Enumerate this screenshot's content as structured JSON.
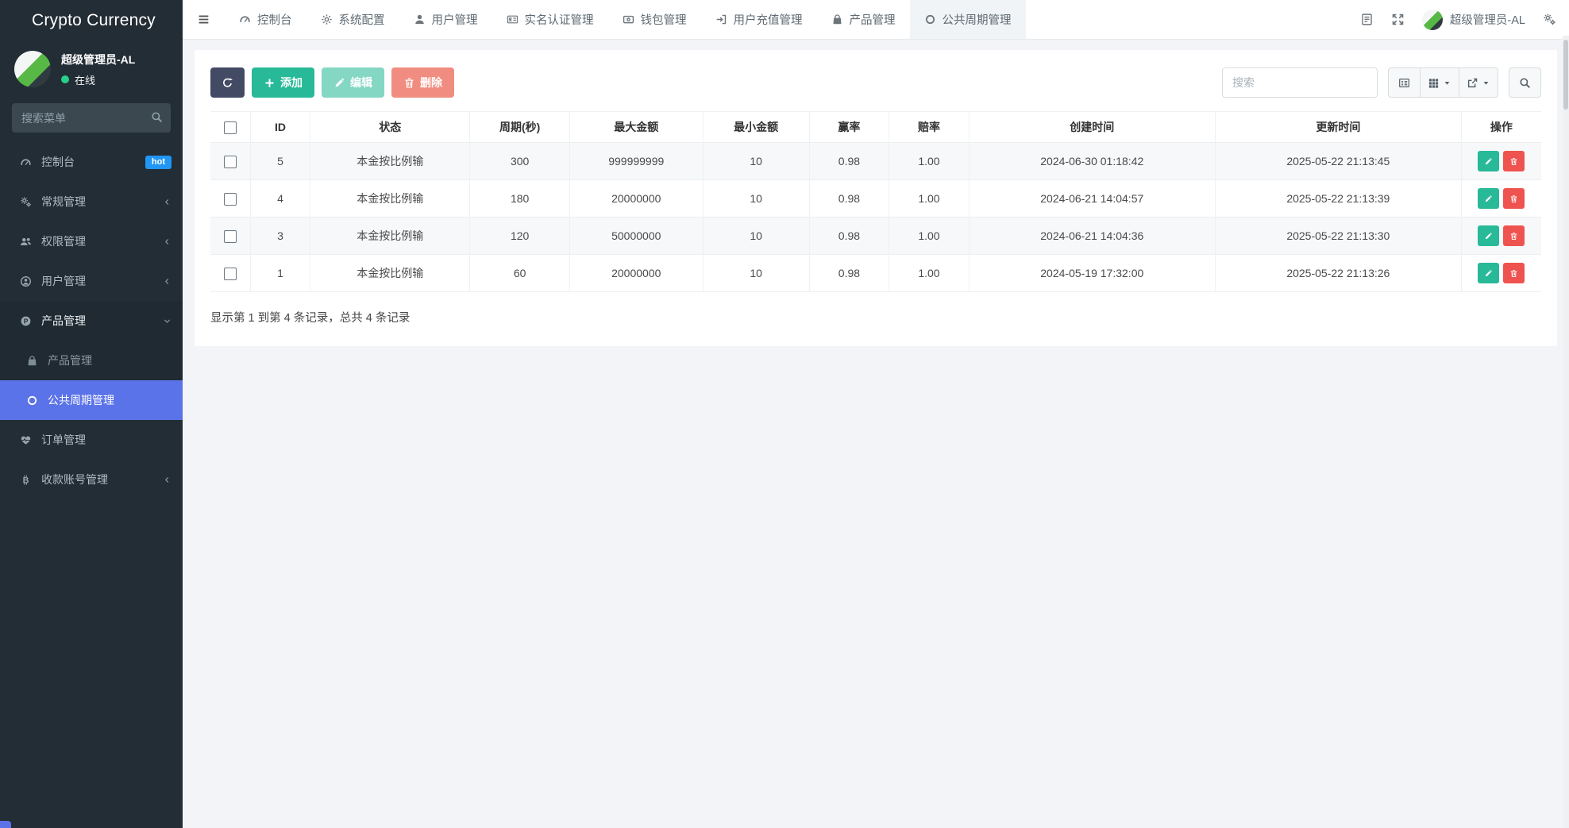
{
  "brand": {
    "title": "Crypto Currency"
  },
  "sidebar": {
    "user": {
      "name": "超级管理员-AL",
      "status_label": "在线"
    },
    "search_placeholder": "搜索菜单",
    "items": [
      {
        "label": "控制台",
        "icon": "dashboard-icon",
        "badge": "hot"
      },
      {
        "label": "常规管理",
        "icon": "cogs-icon",
        "chevron": "left"
      },
      {
        "label": "权限管理",
        "icon": "users-icon",
        "chevron": "left"
      },
      {
        "label": "用户管理",
        "icon": "user-circle-icon",
        "chevron": "left"
      },
      {
        "label": "产品管理",
        "icon": "product-icon",
        "chevron": "down",
        "expanded": true,
        "children": [
          {
            "label": "产品管理",
            "icon": "shopping-bag-icon"
          },
          {
            "label": "公共周期管理",
            "icon": "circle-icon",
            "active": true
          }
        ]
      },
      {
        "label": "订单管理",
        "icon": "heartbeat-icon"
      },
      {
        "label": "收款账号管理",
        "icon": "bitcoin-icon",
        "chevron": "left"
      }
    ]
  },
  "topnav": {
    "tabs": [
      {
        "label": "控制台",
        "icon": "dashboard-icon"
      },
      {
        "label": "系统配置",
        "icon": "gear-icon"
      },
      {
        "label": "用户管理",
        "icon": "user-icon"
      },
      {
        "label": "实名认证管理",
        "icon": "id-card-icon"
      },
      {
        "label": "钱包管理",
        "icon": "wallet-icon"
      },
      {
        "label": "用户充值管理",
        "icon": "sign-in-icon"
      },
      {
        "label": "产品管理",
        "icon": "shopping-bag-icon"
      },
      {
        "label": "公共周期管理",
        "icon": "circle-icon",
        "active": true
      }
    ],
    "right": {
      "username": "超级管理员-AL",
      "icons": [
        "document-icon",
        "fullscreen-icon",
        "avatar",
        "gears-icon"
      ]
    }
  },
  "toolbar": {
    "refresh_icon": "refresh-icon",
    "add_label": "添加",
    "edit_label": "编辑",
    "delete_label": "删除",
    "search_placeholder": "搜索",
    "view_icons": [
      "list-view-icon",
      "columns-icon",
      "export-icon",
      "search-icon"
    ]
  },
  "table": {
    "headers": [
      "ID",
      "状态",
      "周期(秒)",
      "最大金额",
      "最小金额",
      "赢率",
      "赔率",
      "创建时间",
      "更新时间",
      "操作"
    ],
    "rows": [
      {
        "id": "5",
        "status": "本金按比例输",
        "period": "300",
        "max": "999999999",
        "min": "10",
        "win": "0.98",
        "odds": "1.00",
        "created": "2024-06-30 01:18:42",
        "updated": "2025-05-22 21:13:45"
      },
      {
        "id": "4",
        "status": "本金按比例输",
        "period": "180",
        "max": "20000000",
        "min": "10",
        "win": "0.98",
        "odds": "1.00",
        "created": "2024-06-21 14:04:57",
        "updated": "2025-05-22 21:13:39"
      },
      {
        "id": "3",
        "status": "本金按比例输",
        "period": "120",
        "max": "50000000",
        "min": "10",
        "win": "0.98",
        "odds": "1.00",
        "created": "2024-06-21 14:04:36",
        "updated": "2025-05-22 21:13:30"
      },
      {
        "id": "1",
        "status": "本金按比例输",
        "period": "60",
        "max": "20000000",
        "min": "10",
        "win": "0.98",
        "odds": "1.00",
        "created": "2024-05-19 17:32:00",
        "updated": "2025-05-22 21:13:26"
      }
    ],
    "summary": "显示第 1 到第 4 条记录，总共 4 条记录"
  },
  "colors": {
    "sidebar_dark": "#232d35",
    "active_item_blue": "#5b73e8",
    "badge_blue": "#2196f3",
    "success_green": "#27b998",
    "danger_red": "#ef5350",
    "online_green": "#27d08a"
  }
}
